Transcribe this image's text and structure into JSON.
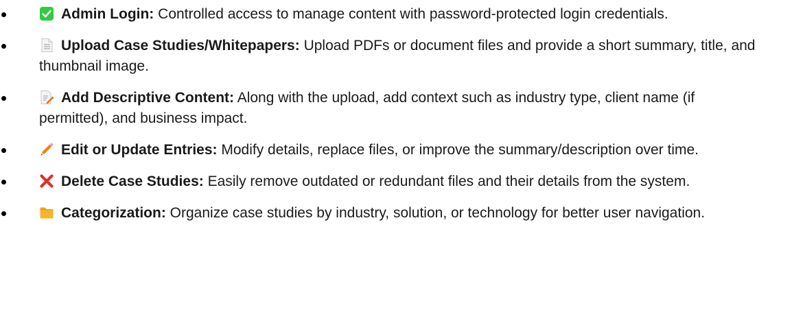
{
  "items": [
    {
      "icon": "check-box-icon",
      "title": "Admin Login:",
      "desc": " Controlled access to manage content with password-protected login credentials."
    },
    {
      "icon": "document-icon",
      "title": "Upload Case Studies/Whitepapers:",
      "desc": " Upload PDFs or document files and provide a short summary, title, and thumbnail image."
    },
    {
      "icon": "document-edit-icon",
      "title": "Add Descriptive Content:",
      "desc": " Along with the upload, add context such as industry type, client name (if permitted), and business impact."
    },
    {
      "icon": "pencil-icon",
      "title": "Edit or Update Entries:",
      "desc": " Modify details, replace files, or improve the summary/description over time."
    },
    {
      "icon": "cross-mark-icon",
      "title": "Delete Case Studies:",
      "desc": " Easily remove outdated or redundant files and their details from the system."
    },
    {
      "icon": "folder-icon",
      "title": "Categorization:",
      "desc": " Organize case studies by industry, solution, or technology for better user navigation."
    }
  ],
  "colors": {
    "check_green": "#2ecc40",
    "pencil_orange": "#f07d1a",
    "cross_red": "#e0302b",
    "folder_yellow": "#f8b42a"
  }
}
